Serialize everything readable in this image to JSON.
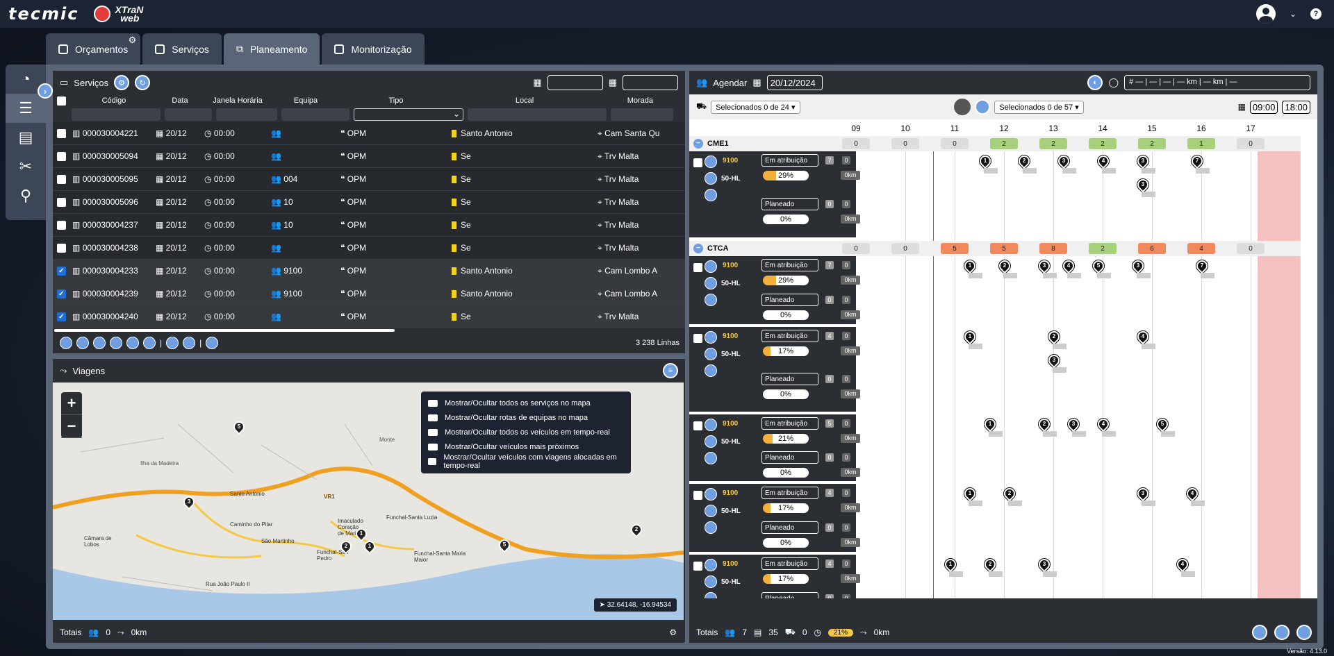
{
  "app": {
    "brand1": "tecmic",
    "brand2a": "XTraN",
    "brand2b": "web",
    "version": "Versão: 4.13.0"
  },
  "tabs": [
    {
      "label": "Orçamentos"
    },
    {
      "label": "Serviços"
    },
    {
      "label": "Planeamento"
    },
    {
      "label": "Monitorização"
    }
  ],
  "servicos": {
    "title": "Serviços",
    "lines": "3 238 Linhas",
    "headers": {
      "codigo": "Código",
      "data": "Data",
      "janela": "Janela Horária",
      "equipa": "Equipa",
      "tipo": "Tipo",
      "local": "Local",
      "morada": "Morada"
    },
    "rows": [
      {
        "codigo": "000030004221",
        "data": "20/12",
        "hora": "00:00",
        "equipa": "",
        "tipo": "OPM",
        "local": "Santo Antonio",
        "morada": "Cam Santa Qu",
        "checked": false
      },
      {
        "codigo": "000030005094",
        "data": "20/12",
        "hora": "00:00",
        "equipa": "",
        "tipo": "OPM",
        "local": "Se",
        "morada": "Trv Malta",
        "checked": false
      },
      {
        "codigo": "000030005095",
        "data": "20/12",
        "hora": "00:00",
        "equipa": "004",
        "tipo": "OPM",
        "local": "Se",
        "morada": "Trv Malta",
        "checked": false
      },
      {
        "codigo": "000030005096",
        "data": "20/12",
        "hora": "00:00",
        "equipa": "10",
        "tipo": "OPM",
        "local": "Se",
        "morada": "Trv Malta",
        "checked": false
      },
      {
        "codigo": "000030004237",
        "data": "20/12",
        "hora": "00:00",
        "equipa": "10",
        "tipo": "OPM",
        "local": "Se",
        "morada": "Trv Malta",
        "checked": false
      },
      {
        "codigo": "000030004238",
        "data": "20/12",
        "hora": "00:00",
        "equipa": "",
        "tipo": "OPM",
        "local": "Se",
        "morada": "Trv Malta",
        "checked": false
      },
      {
        "codigo": "000030004233",
        "data": "20/12",
        "hora": "00:00",
        "equipa": "9100",
        "tipo": "OPM",
        "local": "Santo Antonio",
        "morada": "Cam Lombo A",
        "checked": true
      },
      {
        "codigo": "000030004239",
        "data": "20/12",
        "hora": "00:00",
        "equipa": "9100",
        "tipo": "OPM",
        "local": "Santo Antonio",
        "morada": "Cam Lombo A",
        "checked": true
      },
      {
        "codigo": "000030004240",
        "data": "20/12",
        "hora": "00:00",
        "equipa": "",
        "tipo": "OPM",
        "local": "Se",
        "morada": "Trv Malta",
        "checked": true
      }
    ]
  },
  "viagens": {
    "title": "Viagens",
    "coord": "32.64148, -16.94534",
    "menu": [
      "Mostrar/Ocultar todos os serviços no mapa",
      "Mostrar/Ocultar rotas de equipas no mapa",
      "Mostrar/Ocultar todos os veículos em tempo-real",
      "Mostrar/Ocultar veículos mais próximos",
      "Mostrar/Ocultar veículos com viagens alocadas em tempo-real"
    ],
    "places": {
      "p1": "Ilha da Madeira",
      "p2": "Monte",
      "p3": "Santo Antonio",
      "p4": "Câmara de Lobos",
      "p5": "Caminho do Pilar",
      "p6": "São Martinho",
      "p7": "Imaculado Coração de Maria",
      "p8": "Funchal-Santa Luzia",
      "p9": "Funchal-São Pedro",
      "p10": "Funchal-Santa Maria Maior",
      "p11": "Rua João Paulo II",
      "p12": "VR1"
    },
    "totals": {
      "label": "Totais",
      "teams": "0",
      "km": "0km"
    }
  },
  "agendar": {
    "title": "Agendar",
    "date": "20/12/2024",
    "summary": "# — | — | — | — km | — km | —",
    "sel1": "Selecionados 0 de 24",
    "sel2": "Selecionados 0 de 57",
    "start": "09:00",
    "end": "18:00",
    "hours": [
      "09",
      "10",
      "11",
      "12",
      "13",
      "14",
      "15",
      "16",
      "17"
    ],
    "groups": [
      {
        "name": "CME1",
        "counts": [
          "0",
          "0",
          "0",
          "2",
          "2",
          "2",
          "2",
          "1",
          "0"
        ]
      },
      {
        "name": "CTCA",
        "counts": [
          "0",
          "0",
          "5",
          "5",
          "8",
          "2",
          "6",
          "4",
          "0"
        ]
      }
    ],
    "vehicle": {
      "team": "9100",
      "plate": "50-HL",
      "status1": "Em atribuição",
      "status2": "Planeado",
      "km": "0km"
    },
    "rows": [
      {
        "n": "7",
        "p": "29%"
      },
      {
        "n": "7",
        "p": "29%"
      },
      {
        "n": "4",
        "p": "17%"
      },
      {
        "n": "5",
        "p": "21%"
      },
      {
        "n": "4",
        "p": "17%"
      },
      {
        "n": "4",
        "p": "17%"
      }
    ],
    "totals": {
      "label": "Totais",
      "a": "7",
      "b": "35",
      "c": "0",
      "pct": "21%",
      "km": "0km"
    }
  },
  "colors": {
    "accent": "#6f9fe0",
    "green": "#a6d07a",
    "orange": "#f08a5d",
    "pinkcol": "#f5c0c0"
  }
}
